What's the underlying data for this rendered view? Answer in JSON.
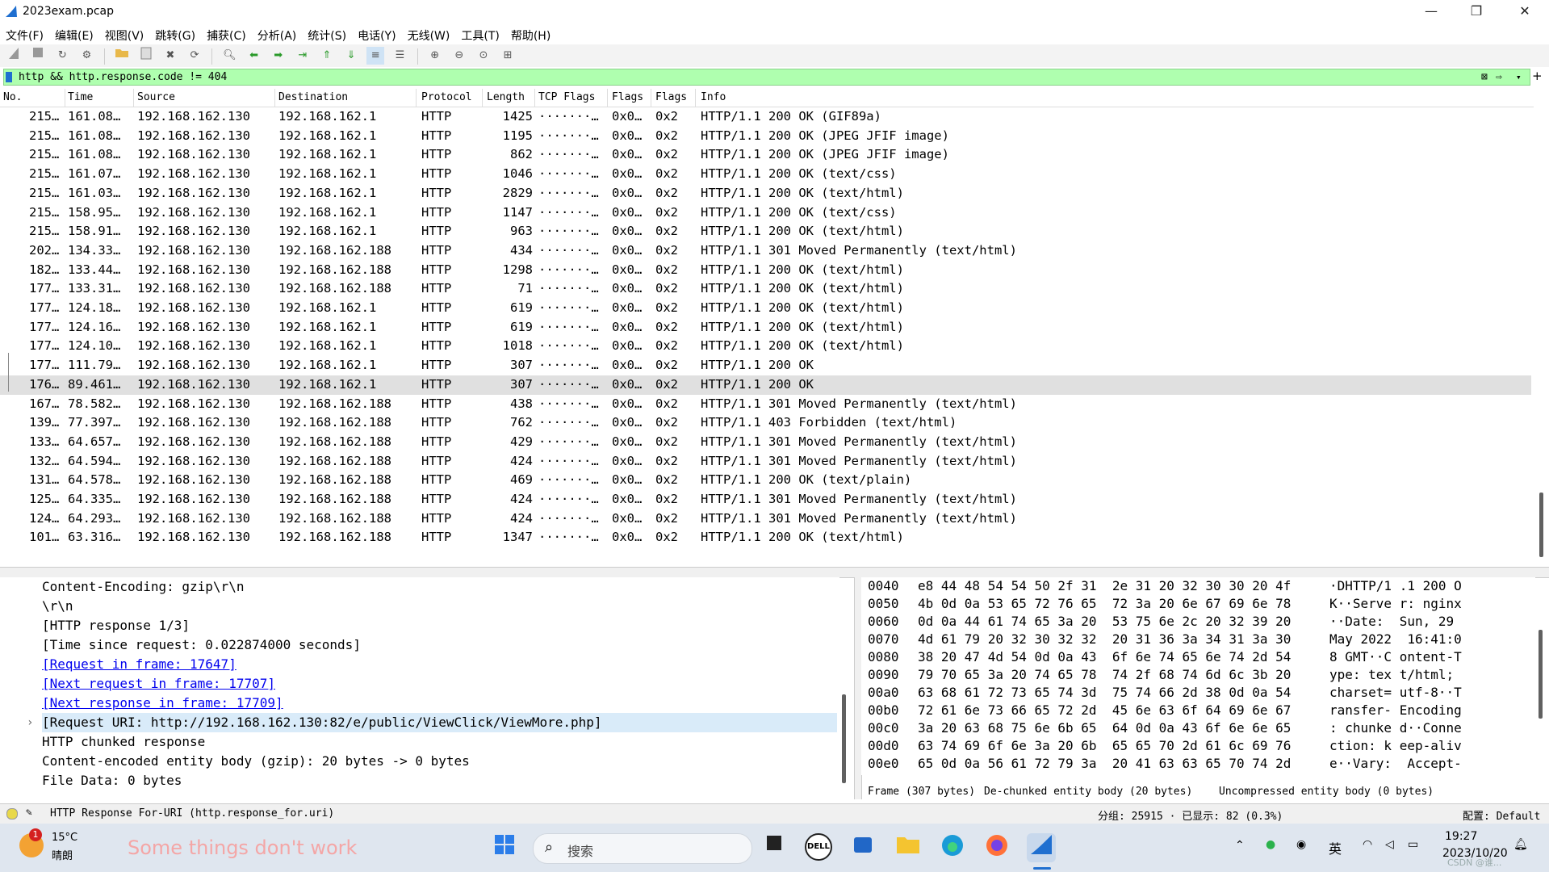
{
  "window": {
    "title": "2023exam.pcap",
    "controls": [
      "—",
      "❐",
      "✕"
    ]
  },
  "menu": [
    "文件(F)",
    "编辑(E)",
    "视图(V)",
    "跳转(G)",
    "捕获(C)",
    "分析(A)",
    "统计(S)",
    "电话(Y)",
    "无线(W)",
    "工具(T)",
    "帮助(H)"
  ],
  "filter": {
    "value": "http && http.response.code != 404"
  },
  "columns": [
    "No.",
    "Time",
    "Source",
    "Destination",
    "Protocol",
    "Length",
    "TCP Flags",
    "Flags",
    "Flags",
    "Info"
  ],
  "packets": [
    [
      "215…",
      "161.08…",
      "192.168.162.130",
      "192.168.162.1",
      "HTTP",
      "1425",
      "·······…",
      "0x0…",
      "0x2",
      "HTTP/1.1 200 OK  (GIF89a)"
    ],
    [
      "215…",
      "161.08…",
      "192.168.162.130",
      "192.168.162.1",
      "HTTP",
      "1195",
      "·······…",
      "0x0…",
      "0x2",
      "HTTP/1.1 200 OK  (JPEG JFIF image)"
    ],
    [
      "215…",
      "161.08…",
      "192.168.162.130",
      "192.168.162.1",
      "HTTP",
      "862",
      "·······…",
      "0x0…",
      "0x2",
      "HTTP/1.1 200 OK  (JPEG JFIF image)"
    ],
    [
      "215…",
      "161.07…",
      "192.168.162.130",
      "192.168.162.1",
      "HTTP",
      "1046",
      "·······…",
      "0x0…",
      "0x2",
      "HTTP/1.1 200 OK  (text/css)"
    ],
    [
      "215…",
      "161.03…",
      "192.168.162.130",
      "192.168.162.1",
      "HTTP",
      "2829",
      "·······…",
      "0x0…",
      "0x2",
      "HTTP/1.1 200 OK  (text/html)"
    ],
    [
      "215…",
      "158.95…",
      "192.168.162.130",
      "192.168.162.1",
      "HTTP",
      "1147",
      "·······…",
      "0x0…",
      "0x2",
      "HTTP/1.1 200 OK  (text/css)"
    ],
    [
      "215…",
      "158.91…",
      "192.168.162.130",
      "192.168.162.1",
      "HTTP",
      "963",
      "·······…",
      "0x0…",
      "0x2",
      "HTTP/1.1 200 OK  (text/html)"
    ],
    [
      "202…",
      "134.33…",
      "192.168.162.130",
      "192.168.162.188",
      "HTTP",
      "434",
      "·······…",
      "0x0…",
      "0x2",
      "HTTP/1.1 301 Moved Permanently  (text/html)"
    ],
    [
      "182…",
      "133.44…",
      "192.168.162.130",
      "192.168.162.188",
      "HTTP",
      "1298",
      "·······…",
      "0x0…",
      "0x2",
      "HTTP/1.1 200 OK  (text/html)"
    ],
    [
      "177…",
      "133.31…",
      "192.168.162.130",
      "192.168.162.188",
      "HTTP",
      "71",
      "·······…",
      "0x0…",
      "0x2",
      "HTTP/1.1 200 OK  (text/html)"
    ],
    [
      "177…",
      "124.18…",
      "192.168.162.130",
      "192.168.162.1",
      "HTTP",
      "619",
      "·······…",
      "0x0…",
      "0x2",
      "HTTP/1.1 200 OK  (text/html)"
    ],
    [
      "177…",
      "124.16…",
      "192.168.162.130",
      "192.168.162.1",
      "HTTP",
      "619",
      "·······…",
      "0x0…",
      "0x2",
      "HTTP/1.1 200 OK  (text/html)"
    ],
    [
      "177…",
      "124.10…",
      "192.168.162.130",
      "192.168.162.1",
      "HTTP",
      "1018",
      "·······…",
      "0x0…",
      "0x2",
      "HTTP/1.1 200 OK  (text/html)"
    ],
    [
      "177…",
      "111.79…",
      "192.168.162.130",
      "192.168.162.1",
      "HTTP",
      "307",
      "·······…",
      "0x0…",
      "0x2",
      "HTTP/1.1 200 OK"
    ],
    [
      "176…",
      "89.461…",
      "192.168.162.130",
      "192.168.162.1",
      "HTTP",
      "307",
      "·······…",
      "0x0…",
      "0x2",
      "HTTP/1.1 200 OK"
    ],
    [
      "167…",
      "78.582…",
      "192.168.162.130",
      "192.168.162.188",
      "HTTP",
      "438",
      "·······…",
      "0x0…",
      "0x2",
      "HTTP/1.1 301 Moved Permanently  (text/html)"
    ],
    [
      "139…",
      "77.397…",
      "192.168.162.130",
      "192.168.162.188",
      "HTTP",
      "762",
      "·······…",
      "0x0…",
      "0x2",
      "HTTP/1.1 403 Forbidden  (text/html)"
    ],
    [
      "133…",
      "64.657…",
      "192.168.162.130",
      "192.168.162.188",
      "HTTP",
      "429",
      "·······…",
      "0x0…",
      "0x2",
      "HTTP/1.1 301 Moved Permanently  (text/html)"
    ],
    [
      "132…",
      "64.594…",
      "192.168.162.130",
      "192.168.162.188",
      "HTTP",
      "424",
      "·······…",
      "0x0…",
      "0x2",
      "HTTP/1.1 301 Moved Permanently  (text/html)"
    ],
    [
      "131…",
      "64.578…",
      "192.168.162.130",
      "192.168.162.188",
      "HTTP",
      "469",
      "·······…",
      "0x0…",
      "0x2",
      "HTTP/1.1 200 OK  (text/plain)"
    ],
    [
      "125…",
      "64.335…",
      "192.168.162.130",
      "192.168.162.188",
      "HTTP",
      "424",
      "·······…",
      "0x0…",
      "0x2",
      "HTTP/1.1 301 Moved Permanently  (text/html)"
    ],
    [
      "124…",
      "64.293…",
      "192.168.162.130",
      "192.168.162.188",
      "HTTP",
      "424",
      "·······…",
      "0x0…",
      "0x2",
      "HTTP/1.1 301 Moved Permanently  (text/html)"
    ],
    [
      "101…",
      "63.316…",
      "192.168.162.130",
      "192.168.162.188",
      "HTTP",
      "1347",
      "·······…",
      "0x0…",
      "0x2",
      "HTTP/1.1 200 OK  (text/html)"
    ]
  ],
  "selected_packet_index": 14,
  "details": [
    {
      "text": "Content-Encoding: gzip\\r\\n",
      "kind": "plain"
    },
    {
      "text": "\\r\\n",
      "kind": "plain"
    },
    {
      "text": "[HTTP response 1/3]",
      "kind": "plain"
    },
    {
      "text": "[Time since request: 0.022874000 seconds]",
      "kind": "plain"
    },
    {
      "text": "[Request in frame: 17647]",
      "kind": "link"
    },
    {
      "text": "[Next request in frame: 17707]",
      "kind": "link"
    },
    {
      "text": "[Next response in frame: 17709]",
      "kind": "link"
    },
    {
      "text": "[Request URI: http://192.168.162.130:82/e/public/ViewClick/ViewMore.php]",
      "kind": "selected"
    },
    {
      "text": "HTTP chunked response",
      "kind": "expandable"
    },
    {
      "text": "Content-encoded entity body (gzip): 20 bytes -> 0 bytes",
      "kind": "plain"
    },
    {
      "text": "File Data: 0 bytes",
      "kind": "plain"
    }
  ],
  "hex": [
    {
      "off": "0040",
      "bytes": "e8 44 48 54 54 50 2f 31  2e 31 20 32 30 30 20 4f",
      "ascii": "·DHTTP/1 .1 200 O"
    },
    {
      "off": "0050",
      "bytes": "4b 0d 0a 53 65 72 76 65  72 3a 20 6e 67 69 6e 78",
      "ascii": "K··Serve r: nginx"
    },
    {
      "off": "0060",
      "bytes": "0d 0a 44 61 74 65 3a 20  53 75 6e 2c 20 32 39 20",
      "ascii": "··Date:  Sun, 29 "
    },
    {
      "off": "0070",
      "bytes": "4d 61 79 20 32 30 32 32  20 31 36 3a 34 31 3a 30",
      "ascii": "May 2022  16:41:0"
    },
    {
      "off": "0080",
      "bytes": "38 20 47 4d 54 0d 0a 43  6f 6e 74 65 6e 74 2d 54",
      "ascii": "8 GMT··C ontent-T"
    },
    {
      "off": "0090",
      "bytes": "79 70 65 3a 20 74 65 78  74 2f 68 74 6d 6c 3b 20",
      "ascii": "ype: tex t/html; "
    },
    {
      "off": "00a0",
      "bytes": "63 68 61 72 73 65 74 3d  75 74 66 2d 38 0d 0a 54",
      "ascii": "charset= utf-8··T"
    },
    {
      "off": "00b0",
      "bytes": "72 61 6e 73 66 65 72 2d  45 6e 63 6f 64 69 6e 67",
      "ascii": "ransfer- Encoding"
    },
    {
      "off": "00c0",
      "bytes": "3a 20 63 68 75 6e 6b 65  64 0d 0a 43 6f 6e 6e 65",
      "ascii": ": chunke d··Conne"
    },
    {
      "off": "00d0",
      "bytes": "63 74 69 6f 6e 3a 20 6b  65 65 70 2d 61 6c 69 76",
      "ascii": "ction: k eep-aliv"
    },
    {
      "off": "00e0",
      "bytes": "65 0d 0a 56 61 72 79 3a  20 41 63 63 65 70 74 2d",
      "ascii": "e··Vary:  Accept-"
    }
  ],
  "hex_tabs": [
    "Frame (307 bytes)",
    "De-chunked entity body (20 bytes)",
    "Uncompressed entity body (0 bytes)"
  ],
  "status": {
    "field": "HTTP Response For-URI (http.response_for.uri)",
    "counts": "分组: 25915 · 已显示: 82 (0.3%)",
    "profile": "配置: Default"
  },
  "taskbar": {
    "weather_temp": "15°C",
    "weather_desc": "晴朗",
    "weather_badge": "1",
    "marquee": "Some things don't work",
    "search": "搜索",
    "ime": "英",
    "time": "19:27",
    "date": "2023/10/20",
    "watermark": "CSDN @谁..."
  },
  "colors": {
    "filter_bg": "#afffaf",
    "selected_row": "#e0e0e0",
    "link": "#0000ee",
    "detail_highlight": "#d9ebf9"
  }
}
